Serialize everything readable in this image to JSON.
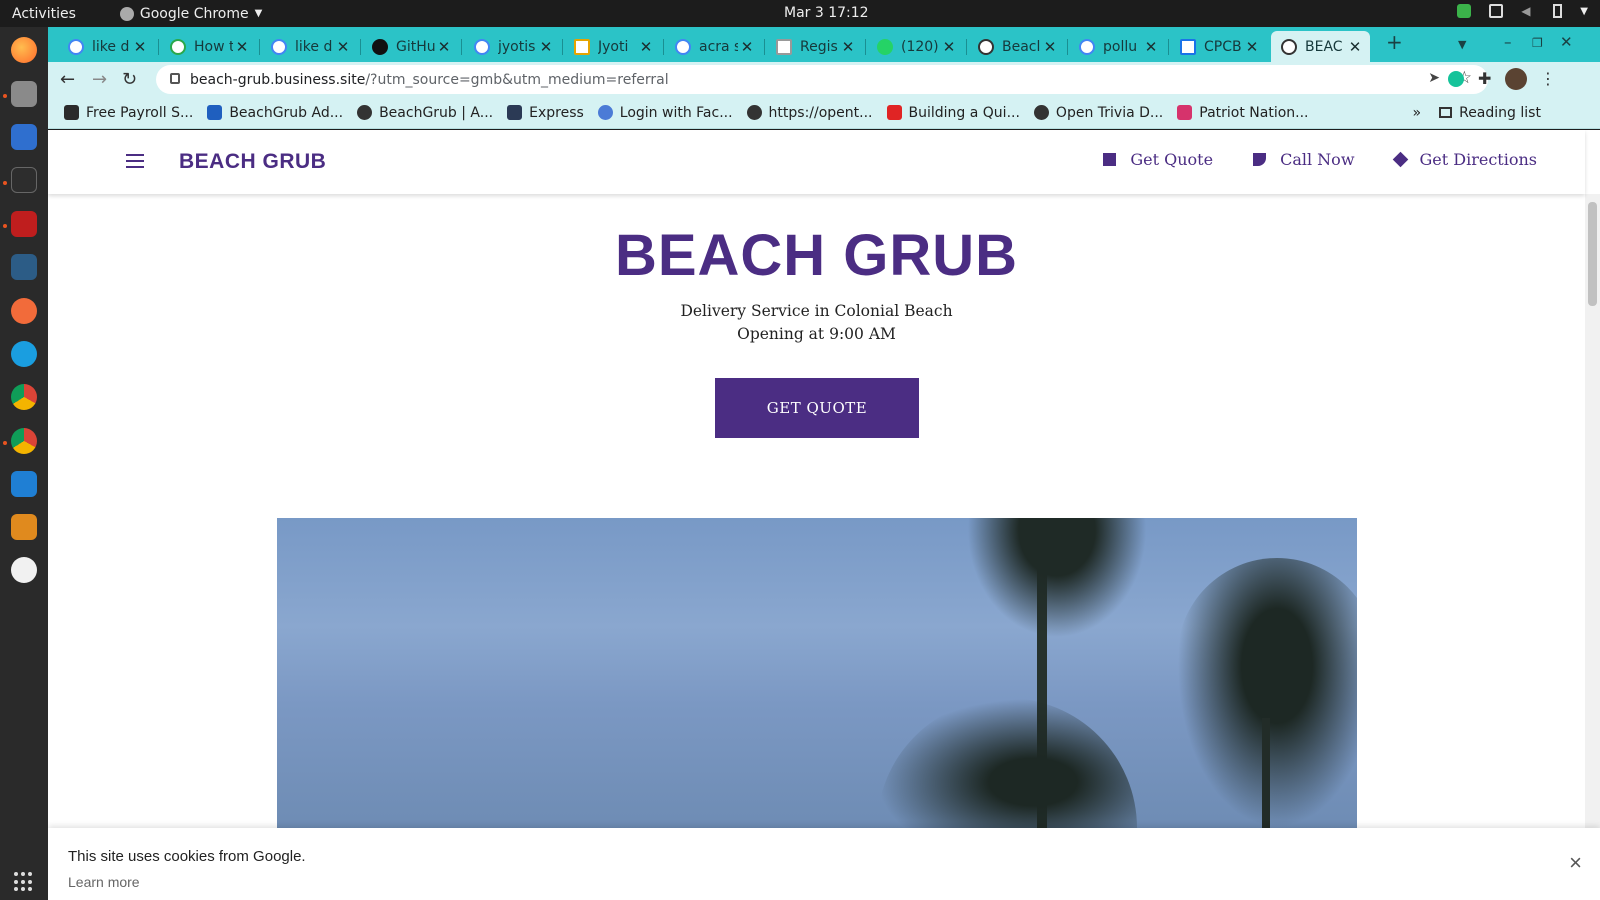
{
  "system": {
    "activities": "Activities",
    "app_name": "Google Chrome",
    "clock": "Mar 3  17:12"
  },
  "tabs": [
    {
      "title": "like d"
    },
    {
      "title": "How t"
    },
    {
      "title": "like d"
    },
    {
      "title": "GitHu"
    },
    {
      "title": "jyotis"
    },
    {
      "title": "Jyoti"
    },
    {
      "title": "acra s"
    },
    {
      "title": "Regis"
    },
    {
      "title": "(120)"
    },
    {
      "title": "Beacl"
    },
    {
      "title": "pollu"
    },
    {
      "title": "CPCB"
    },
    {
      "title": "BEAC"
    }
  ],
  "address_bar": {
    "host": "beach-grub.business.site",
    "path": "/?utm_source=gmb&utm_medium=referral"
  },
  "bookmarks": [
    {
      "label": "Free Payroll S...",
      "color": "#2b2b2b"
    },
    {
      "label": "BeachGrub Ad...",
      "color": "#1f5fbf"
    },
    {
      "label": "BeachGrub | A...",
      "color": "#333333"
    },
    {
      "label": "Express",
      "color": "#2b3a55"
    },
    {
      "label": "Login with Fac...",
      "color": "#4b7bd6"
    },
    {
      "label": "https://opent...",
      "color": "#333333"
    },
    {
      "label": "Building a Qui...",
      "color": "#e02424"
    },
    {
      "label": "Open Trivia D...",
      "color": "#333333"
    },
    {
      "label": "Patriot Nation...",
      "color": "#d6336c"
    }
  ],
  "bookmarks_more": "»",
  "reading_list": "Reading list",
  "site": {
    "brand": "BEACH GRUB",
    "nav": [
      {
        "label": "Get Quote"
      },
      {
        "label": "Call Now"
      },
      {
        "label": "Get Directions"
      }
    ],
    "hero_title": "BEACH GRUB",
    "subtitle_line1": "Delivery Service in Colonial Beach",
    "subtitle_line2": "Opening at 9:00 AM",
    "cta": "GET QUOTE",
    "brand_color": "#4b2d83"
  },
  "cookie_banner": {
    "message": "This site uses cookies from Google.",
    "learn_more": "Learn more",
    "close": "×"
  }
}
